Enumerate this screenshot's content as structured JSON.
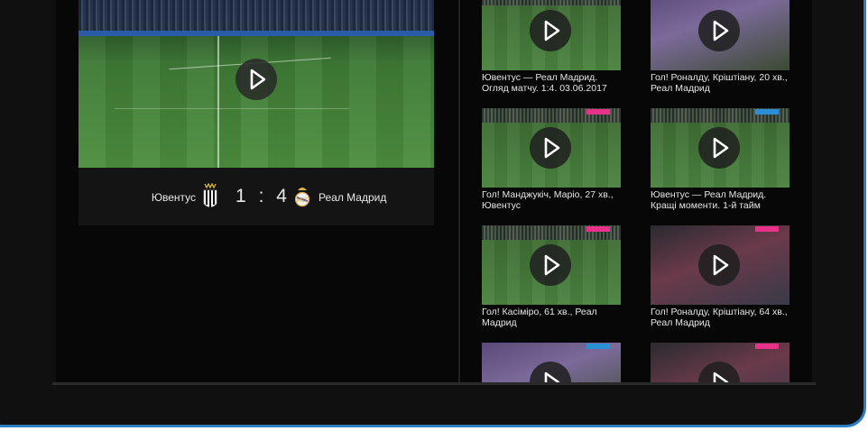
{
  "match": {
    "home_team": "Ювентус",
    "away_team": "Реал Мадрид",
    "home_score": "1",
    "separator": ":",
    "away_score": "4"
  },
  "colors": {
    "badge_pink": "#e8328a",
    "badge_blue": "#2b8fd6",
    "frame_accent": "#2b7fc0"
  },
  "related": [
    {
      "title": "Ювентус — Реал Мадрид. Огляд матчу. 1:4. 03.06.2017",
      "badge": ""
    },
    {
      "title": "Гол! Роналду, Кріштіану, 20 хв., Реал Мадрид",
      "badge": ""
    },
    {
      "title": "Гол! Манджукіч, Маріо, 27 хв., Ювентус",
      "badge": "pink"
    },
    {
      "title": "Ювентус — Реал Мадрид. Кращі моменти. 1-й тайм",
      "badge": "blue"
    },
    {
      "title": "Гол! Касіміро, 61 хв., Реал Мадрид",
      "badge": "pink"
    },
    {
      "title": "Гол! Роналду, Кріштіану, 64 хв., Реал Мадрид",
      "badge": "pink"
    },
    {
      "title": "",
      "badge": "blue"
    },
    {
      "title": "",
      "badge": "pink"
    }
  ],
  "icons": {
    "play": "play-icon",
    "home_crest": "juventus-crest-icon",
    "away_crest": "real-madrid-crest-icon"
  }
}
